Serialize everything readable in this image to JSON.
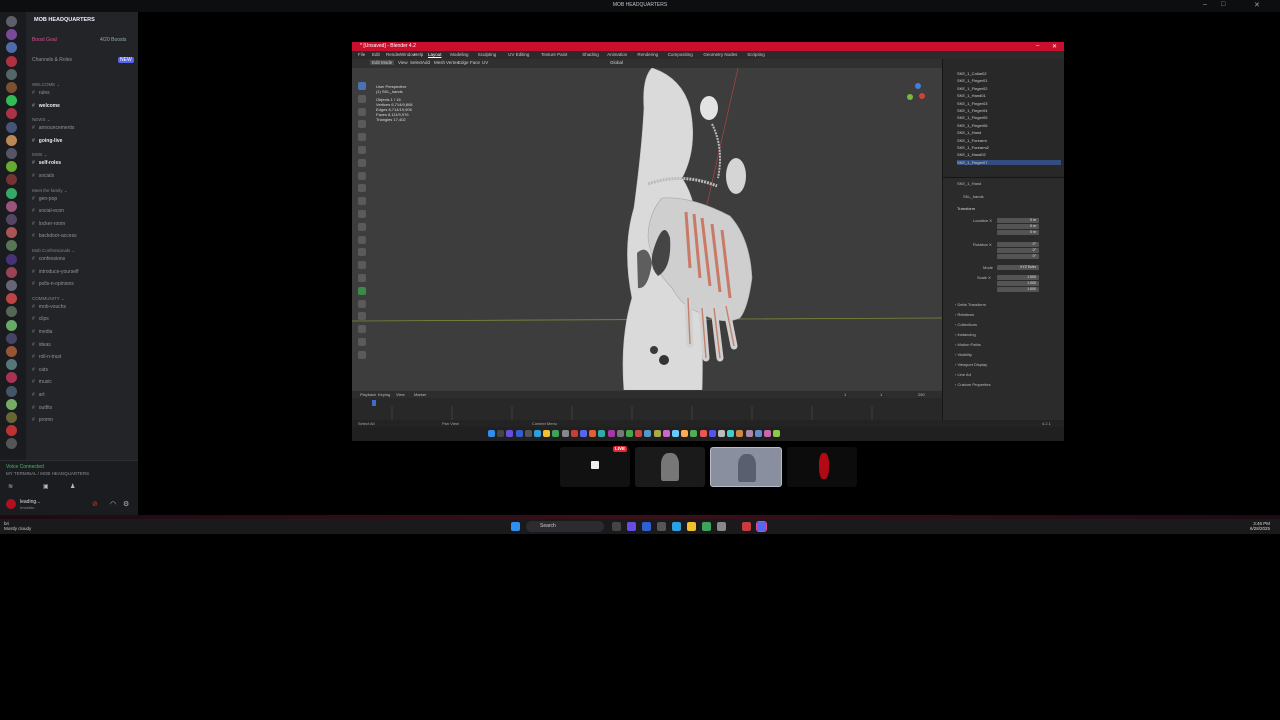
{
  "window": {
    "title": "MOB HEADQUARTERS",
    "controls": [
      "–",
      "□",
      "✕"
    ]
  },
  "discord": {
    "server_name": "MOB HEADQUARTERS",
    "boost_goal": "Boost Goal",
    "boost_count": "4/20 Boosts",
    "channels_roles": "Channels & Roles",
    "new_badge": "NEW",
    "items": [
      {
        "kind": "cat",
        "text": "WELCOME ⌄"
      },
      {
        "kind": "ch",
        "text": "rules"
      },
      {
        "kind": "ch",
        "text": "welcome",
        "bright": true
      },
      {
        "kind": "cat",
        "text": "NEWS ⌄"
      },
      {
        "kind": "ch",
        "text": "announcements"
      },
      {
        "kind": "ch",
        "text": "going-live",
        "bright": true
      },
      {
        "kind": "cat",
        "text": "MOB ⌄"
      },
      {
        "kind": "ch",
        "text": "self-roles",
        "bright": true
      },
      {
        "kind": "ch",
        "text": "socials"
      },
      {
        "kind": "cat",
        "text": "Meet the family ⌄"
      },
      {
        "kind": "ch",
        "text": "gen-pop"
      },
      {
        "kind": "ch",
        "text": "social-econ"
      },
      {
        "kind": "ch",
        "text": "locker-room"
      },
      {
        "kind": "ch",
        "text": "backdoor-access"
      },
      {
        "kind": "cat",
        "text": "Mob Confessionals ⌄"
      },
      {
        "kind": "ch",
        "text": "confessions"
      },
      {
        "kind": "ch",
        "text": "introduce-yourself"
      },
      {
        "kind": "ch",
        "text": "polls-n-opinions"
      },
      {
        "kind": "cat",
        "text": "COMMUNITY ⌄"
      },
      {
        "kind": "ch",
        "text": "mob-vouchs"
      },
      {
        "kind": "ch",
        "text": "clips"
      },
      {
        "kind": "ch",
        "text": "media"
      },
      {
        "kind": "ch",
        "text": "ideas"
      },
      {
        "kind": "ch",
        "text": "roll-n-trust"
      },
      {
        "kind": "ch",
        "text": "cats"
      },
      {
        "kind": "ch",
        "text": "music"
      },
      {
        "kind": "ch",
        "text": "art"
      },
      {
        "kind": "ch",
        "text": "outfits"
      },
      {
        "kind": "ch",
        "text": "promo"
      }
    ],
    "voice_status": "Voice Connected",
    "voice_channel": "MY TERMINAL / MOB HEADQUARTERS",
    "user_name": "leading...",
    "user_sub": "Invisible"
  },
  "blender": {
    "title": "* [Unsaved] - Blender 4.2",
    "menu": [
      "File",
      "Edit",
      "Render",
      "Window",
      "Help",
      "Layout",
      "Modeling",
      "Sculpting",
      "UV Editing",
      "Texture Paint",
      "Shading",
      "Animation",
      "Rendering",
      "Compositing",
      "Geometry Nodes",
      "Scripting"
    ],
    "header_mode": "Edit Mode",
    "view_menu": [
      "View",
      "Select",
      "Add",
      "Mesh",
      "Vertex",
      "Edge",
      "Face",
      "UV"
    ],
    "transform_orient": "Global",
    "stats": {
      "title": "User Perspective",
      "object": "(1) SKL_hands",
      "rows": [
        "Objects   1 / 16",
        "Vertices  6,714/9,808",
        "Edges     8,714/19,906",
        "Faces     8,111/9,976",
        "Triangles 17,402"
      ]
    },
    "outliner": [
      "SKE_1_Collar02",
      "SKE_1_Finger01",
      "SKE_1_Finger02",
      "SKE_1_Hand01",
      "SKE_1_Finger03",
      "SKE_1_Finger04",
      "SKE_1_Finger05",
      "SKE_1_Finger06",
      "SKE_1_Hand",
      "SKE_1_Forearm",
      "SKE_1_Forearm2",
      "SKE_1_Hand02",
      "SKE_1_Finger07"
    ],
    "props": {
      "object_name": "SKE_1_Hand",
      "mesh_name": "SKL_hands",
      "section": "Transform",
      "location": [
        "0 m",
        "0 m",
        "0 m"
      ],
      "rotation": [
        "0°",
        "0°",
        "0°"
      ],
      "mode": "XYZ Euler",
      "scale": [
        "1.000",
        "1.000",
        "1.000"
      ],
      "panels": [
        "Delta Transform",
        "Relations",
        "Collections",
        "Instancing",
        "Motion Paths",
        "Visibility",
        "Viewport Display",
        "Line Art",
        "Custom Properties"
      ],
      "labels": {
        "location": "Location X",
        "rotation": "Rotation X",
        "mode": "Mode",
        "scale": "Scale X"
      }
    },
    "timeline": {
      "menus": [
        "Playback",
        "Keying",
        "View",
        "Marker"
      ],
      "frame": "1",
      "start": "1",
      "end": "250"
    },
    "status": [
      "Select All",
      "Pan View",
      "Context Menu"
    ],
    "version": "4.2.1"
  },
  "thumbs": {
    "live": "LIVE"
  },
  "taskbar": {
    "search": "Search",
    "time": "3:46 PM",
    "date": "6/28/2025",
    "user_line1": "bri",
    "user_line2": "Mostly cloudy"
  },
  "colors": {
    "accent": "#c8102e",
    "voice_green": "#3fbf6a"
  }
}
